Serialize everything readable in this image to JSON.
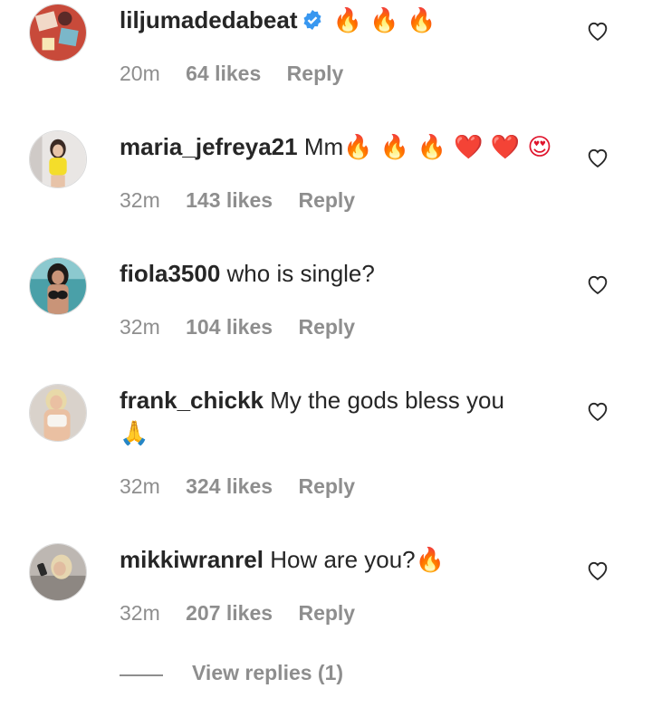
{
  "comments": [
    {
      "username": "liljumadedabeat",
      "verified": true,
      "text": "",
      "emojis": "🔥 🔥 🔥",
      "time": "20m",
      "likes": "64 likes",
      "reply": "Reply"
    },
    {
      "username": "maria_jefreya21",
      "text": "Mm",
      "emojis": "🔥 🔥 🔥 ❤️ ❤️ 😍",
      "time": "32m",
      "likes": "143 likes",
      "reply": "Reply"
    },
    {
      "username": "fiola3500",
      "text": "who is single?",
      "time": "32m",
      "likes": "104 likes",
      "reply": "Reply"
    },
    {
      "username": "frank_chickk",
      "text": "My the gods bless you",
      "emojis": "🙏",
      "time": "32m",
      "likes": "324 likes",
      "reply": "Reply"
    },
    {
      "username": "mikkiwranrel",
      "text": "How are you?",
      "emojis": "🔥",
      "time": "32m",
      "likes": "207 likes",
      "reply": "Reply"
    }
  ],
  "view_replies": "View replies (1)",
  "colors": {
    "text": "#262626",
    "muted": "#8e8e8e",
    "verified": "#3897f0"
  }
}
